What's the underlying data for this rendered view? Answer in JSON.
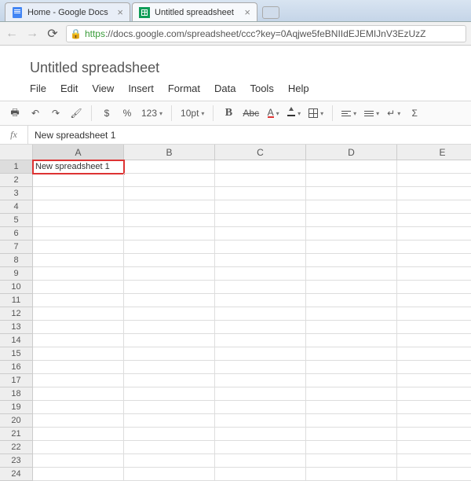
{
  "browser": {
    "tabs": [
      {
        "title": "Home - Google Docs",
        "active": false
      },
      {
        "title": "Untitled spreadsheet",
        "active": true
      }
    ],
    "url_proto": "https",
    "url_rest": "://docs.google.com/spreadsheet/ccc?key=0Aqjwe5feBNIIdEJEMIJnV3EzUzZ"
  },
  "doc": {
    "title": "Untitled spreadsheet",
    "menu": [
      "File",
      "Edit",
      "View",
      "Insert",
      "Format",
      "Data",
      "Tools",
      "Help"
    ]
  },
  "toolbar": {
    "currency": "$",
    "percent": "%",
    "number_format": "123",
    "font_size": "10pt",
    "bold": "B",
    "strike": "Abc",
    "text_color": "A",
    "sigma": "Σ"
  },
  "formula": {
    "label": "fx",
    "value": "New spreadsheet 1"
  },
  "grid": {
    "columns": [
      "A",
      "B",
      "C",
      "D",
      "E"
    ],
    "rows": 24,
    "active_cell": {
      "row": 1,
      "col": "A"
    },
    "cells": {
      "A1": "New spreadsheet 1"
    }
  }
}
